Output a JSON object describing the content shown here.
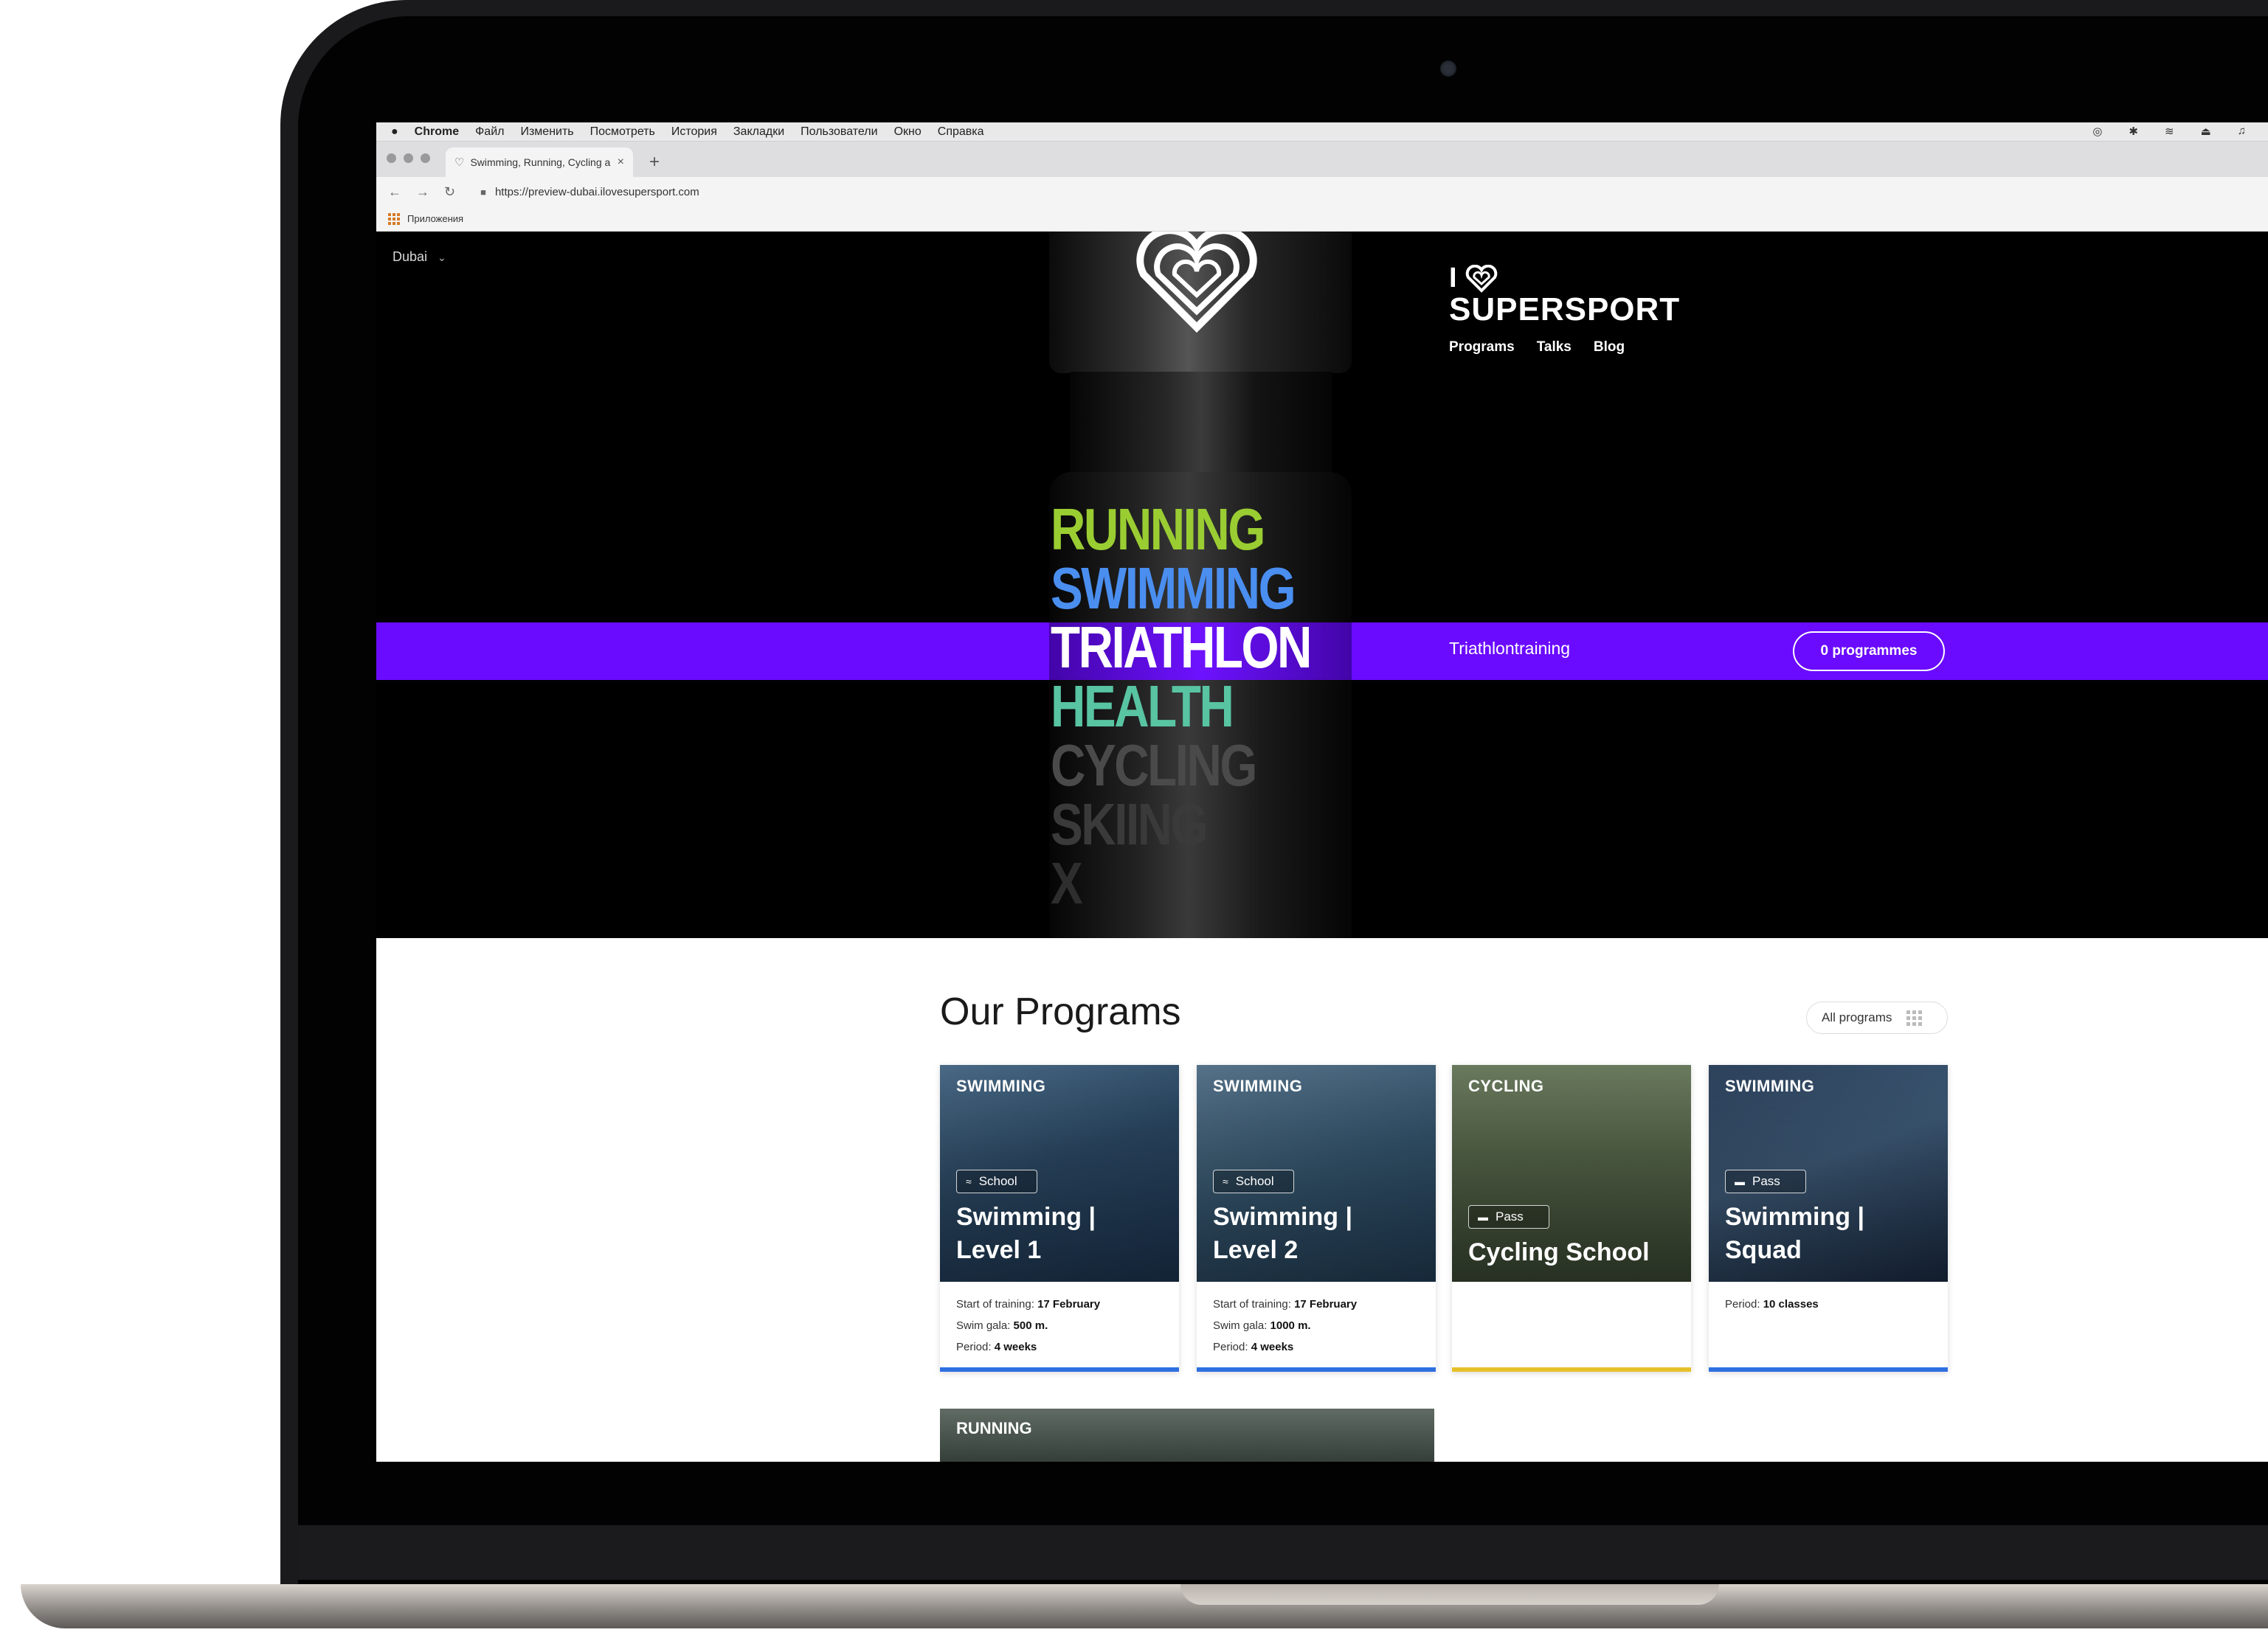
{
  "menubar": {
    "apple": "",
    "app": "Chrome",
    "items": [
      "Файл",
      "Изменить",
      "Посмотреть",
      "История",
      "Закладки",
      "Пользователи",
      "Окно",
      "Справка"
    ]
  },
  "browser": {
    "tab_title": "Swimming, Running, Cycling a",
    "url": "https://preview-dubai.ilovesupersport.com",
    "bookmarks_label": "Приложения"
  },
  "hero": {
    "city": "Dubai",
    "brand_line1": "I",
    "brand_line2": "SUPERSPORT",
    "nav": [
      "Programs",
      "Talks",
      "Blog"
    ],
    "sports": [
      {
        "label": "RUNNING",
        "color": "#9acd32"
      },
      {
        "label": "SWIMMING",
        "color": "#4a8ef0"
      },
      {
        "label": "TRIATHLON",
        "color": "#ffffff"
      },
      {
        "label": "HEALTH",
        "color": "#58c4a2"
      },
      {
        "label": "CYCLING",
        "color": "#4a4a4a"
      },
      {
        "label": "SKIING",
        "color": "#3a3a3a"
      },
      {
        "label": "X",
        "color": "#2e2e2e"
      }
    ],
    "band_label": "Triathlontraining",
    "band_button": "0 programmes",
    "accent": "#6a0bff"
  },
  "programs": {
    "title": "Our Programs",
    "all_button": "All programs",
    "cards": [
      {
        "category": "SWIMMING",
        "badge": "School",
        "badge_icon": "swimmer-icon",
        "name": [
          "Swimming |",
          "Level 1"
        ],
        "meta": [
          {
            "k": "Start of training:",
            "v": "17 February"
          },
          {
            "k": "Swim gala:",
            "v": "500 m."
          },
          {
            "k": "Period:",
            "v": "4 weeks"
          }
        ],
        "bar_color": "#2f6fe0"
      },
      {
        "category": "SWIMMING",
        "badge": "School",
        "badge_icon": "swimmer-icon",
        "name": [
          "Swimming |",
          "Level 2"
        ],
        "meta": [
          {
            "k": "Start of training:",
            "v": "17 February"
          },
          {
            "k": "Swim gala:",
            "v": "1000 m."
          },
          {
            "k": "Period:",
            "v": "4 weeks"
          }
        ],
        "bar_color": "#2f6fe0"
      },
      {
        "category": "CYCLING",
        "badge": "Pass",
        "badge_icon": "card-icon",
        "name": [
          "Cycling School"
        ],
        "meta": [],
        "bar_color": "#e6c02a"
      },
      {
        "category": "SWIMMING",
        "badge": "Pass",
        "badge_icon": "card-icon",
        "name": [
          "Swimming |",
          "Squad"
        ],
        "meta": [
          {
            "k": "Period:",
            "v": "10 classes"
          }
        ],
        "bar_color": "#2f6fe0"
      }
    ],
    "next_category": "RUNNING"
  }
}
